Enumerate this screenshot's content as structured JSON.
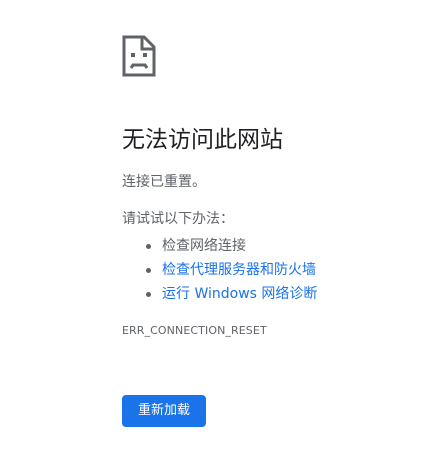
{
  "icon": "sad-document-icon",
  "title": "无法访问此网站",
  "subtitle": "连接已重置。",
  "suggestions_heading": "请试试以下办法：",
  "suggestions": [
    {
      "label": "检查网络连接",
      "is_link": false
    },
    {
      "label": "检查代理服务器和防火墙",
      "is_link": true
    },
    {
      "label": "运行 Windows 网络诊断",
      "is_link": true
    }
  ],
  "error_code": "ERR_CONNECTION_RESET",
  "reload_label": "重新加载",
  "colors": {
    "accent": "#1a73e8",
    "text_primary": "#202124",
    "text_secondary": "#5f6368",
    "background": "#ffffff"
  }
}
